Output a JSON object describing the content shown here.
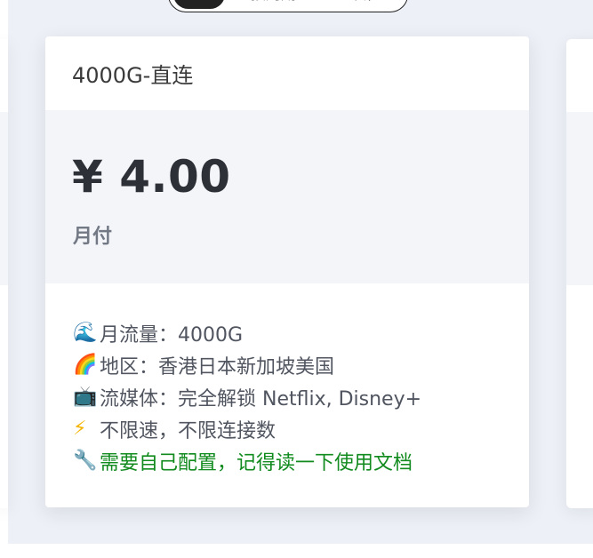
{
  "filter": {
    "tabs": [
      {
        "label": "全部",
        "active": true
      },
      {
        "label": "按周期",
        "active": false
      },
      {
        "label": "一次性",
        "active": false
      }
    ]
  },
  "card": {
    "title": "4000G-直连",
    "price": "¥ 4.00",
    "period": "月付",
    "features": [
      {
        "icon": "wave-icon",
        "glyph": "🌊",
        "text": "月流量：4000G",
        "highlight": false
      },
      {
        "icon": "rainbow-icon",
        "glyph": "🌈",
        "text": "地区：香港日本新加坡美国",
        "highlight": false
      },
      {
        "icon": "tv-icon",
        "glyph": "📺",
        "text": "流媒体：完全解锁 Netflix, Disney+",
        "highlight": false
      },
      {
        "icon": "lightning-icon",
        "glyph": "⚡",
        "text": "不限速，不限连接数",
        "highlight": false
      },
      {
        "icon": "wrench-icon",
        "glyph": "🔧",
        "text": "需要自己配置，记得读一下使用文档",
        "highlight": true
      }
    ]
  },
  "colors": {
    "page_bg": "#edf0f6",
    "card_bg": "#ffffff",
    "price_block_bg": "#f4f5f9",
    "highlight_text": "#118a1e",
    "active_tab_bg": "#222222"
  }
}
